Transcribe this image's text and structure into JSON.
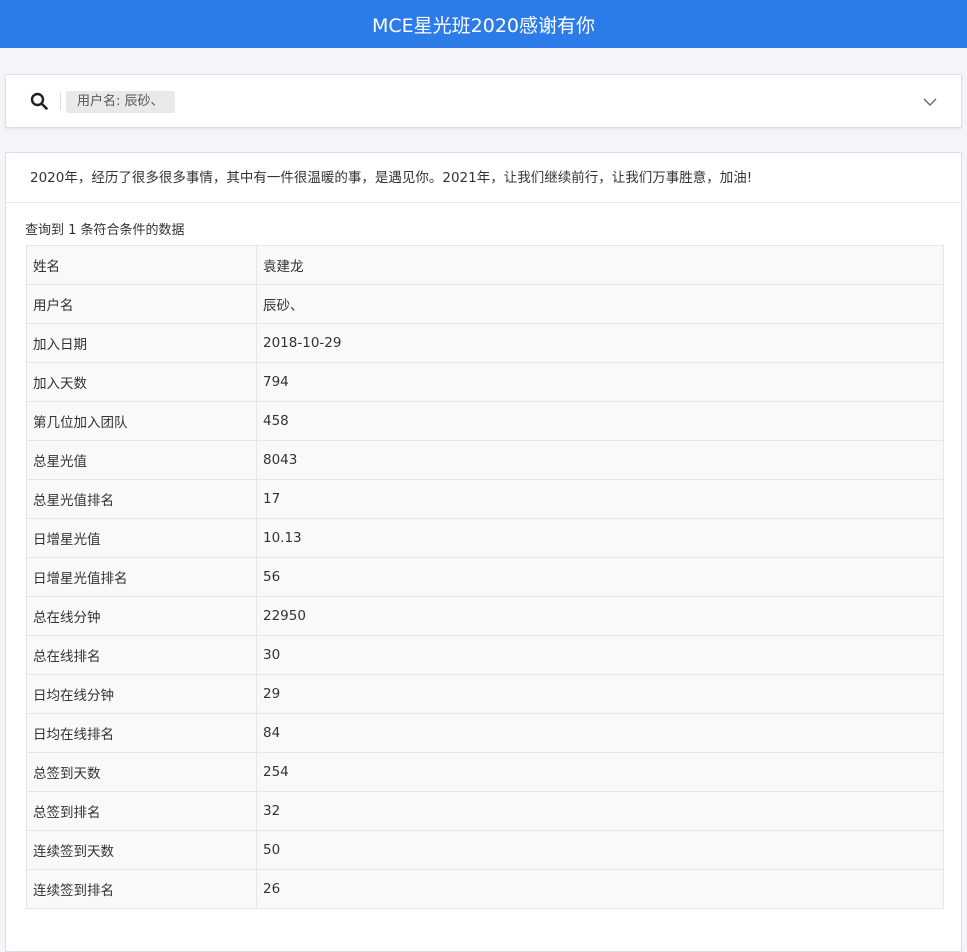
{
  "header": {
    "title": "MCE星光班2020感谢有你"
  },
  "search": {
    "icon": "search-icon",
    "chip_label": "用户名: 辰砂、",
    "expand_icon": "chevron-down-icon"
  },
  "main": {
    "message": "2020年，经历了很多很多事情，其中有一件很温暖的事，是遇见你。2021年，让我们继续前行，让我们万事胜意，加油!",
    "result_count": "查询到 1 条符合条件的数据",
    "rows": [
      {
        "label": "姓名",
        "value": "袁建龙"
      },
      {
        "label": "用户名",
        "value": "辰砂、"
      },
      {
        "label": "加入日期",
        "value": "2018-10-29"
      },
      {
        "label": "加入天数",
        "value": "794"
      },
      {
        "label": "第几位加入团队",
        "value": "458"
      },
      {
        "label": "总星光值",
        "value": "8043"
      },
      {
        "label": "总星光值排名",
        "value": "17"
      },
      {
        "label": "日增星光值",
        "value": "10.13"
      },
      {
        "label": "日增星光值排名",
        "value": "56"
      },
      {
        "label": "总在线分钟",
        "value": "22950"
      },
      {
        "label": "总在线排名",
        "value": "30"
      },
      {
        "label": "日均在线分钟",
        "value": "29"
      },
      {
        "label": "日均在线排名",
        "value": "84"
      },
      {
        "label": "总签到天数",
        "value": "254"
      },
      {
        "label": "总签到排名",
        "value": "32"
      },
      {
        "label": "连续签到天数",
        "value": "50"
      },
      {
        "label": "连续签到排名",
        "value": "26"
      }
    ]
  },
  "colors": {
    "header_bg": "#2b7be8",
    "page_bg": "#f4f5f8"
  }
}
